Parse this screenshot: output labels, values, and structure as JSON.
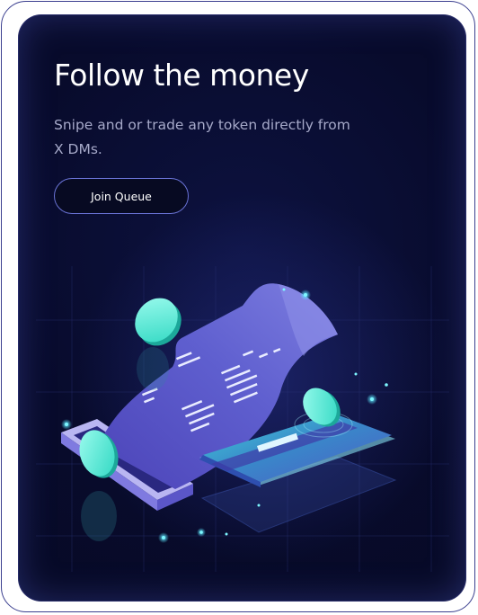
{
  "hero": {
    "title": "Follow the money",
    "subtitle": "Snipe and or trade any token directly from X DMs.",
    "cta_label": "Join Queue"
  },
  "illustration": {
    "name": "receipt-card-coins-illustration"
  },
  "colors": {
    "background": "#0a0e33",
    "accent_teal": "#3ef2d8",
    "receipt_purple": "#5a55c8",
    "button_border": "#6a73d6"
  }
}
